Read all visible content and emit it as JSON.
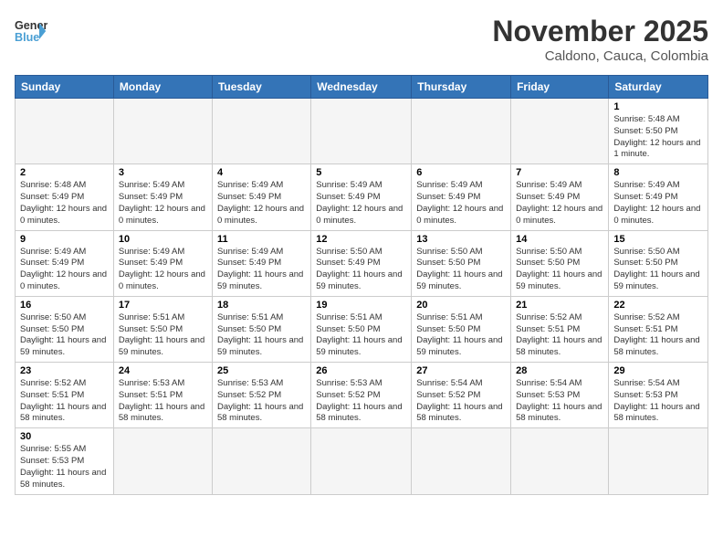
{
  "header": {
    "logo_general": "General",
    "logo_blue": "Blue",
    "month_title": "November 2025",
    "location": "Caldono, Cauca, Colombia"
  },
  "weekdays": [
    "Sunday",
    "Monday",
    "Tuesday",
    "Wednesday",
    "Thursday",
    "Friday",
    "Saturday"
  ],
  "weeks": [
    [
      {
        "day": "",
        "info": ""
      },
      {
        "day": "",
        "info": ""
      },
      {
        "day": "",
        "info": ""
      },
      {
        "day": "",
        "info": ""
      },
      {
        "day": "",
        "info": ""
      },
      {
        "day": "",
        "info": ""
      },
      {
        "day": "1",
        "info": "Sunrise: 5:48 AM\nSunset: 5:50 PM\nDaylight: 12 hours and 1 minute."
      }
    ],
    [
      {
        "day": "2",
        "info": "Sunrise: 5:48 AM\nSunset: 5:49 PM\nDaylight: 12 hours and 0 minutes."
      },
      {
        "day": "3",
        "info": "Sunrise: 5:49 AM\nSunset: 5:49 PM\nDaylight: 12 hours and 0 minutes."
      },
      {
        "day": "4",
        "info": "Sunrise: 5:49 AM\nSunset: 5:49 PM\nDaylight: 12 hours and 0 minutes."
      },
      {
        "day": "5",
        "info": "Sunrise: 5:49 AM\nSunset: 5:49 PM\nDaylight: 12 hours and 0 minutes."
      },
      {
        "day": "6",
        "info": "Sunrise: 5:49 AM\nSunset: 5:49 PM\nDaylight: 12 hours and 0 minutes."
      },
      {
        "day": "7",
        "info": "Sunrise: 5:49 AM\nSunset: 5:49 PM\nDaylight: 12 hours and 0 minutes."
      },
      {
        "day": "8",
        "info": "Sunrise: 5:49 AM\nSunset: 5:49 PM\nDaylight: 12 hours and 0 minutes."
      }
    ],
    [
      {
        "day": "9",
        "info": "Sunrise: 5:49 AM\nSunset: 5:49 PM\nDaylight: 12 hours and 0 minutes."
      },
      {
        "day": "10",
        "info": "Sunrise: 5:49 AM\nSunset: 5:49 PM\nDaylight: 12 hours and 0 minutes."
      },
      {
        "day": "11",
        "info": "Sunrise: 5:49 AM\nSunset: 5:49 PM\nDaylight: 11 hours and 59 minutes."
      },
      {
        "day": "12",
        "info": "Sunrise: 5:50 AM\nSunset: 5:49 PM\nDaylight: 11 hours and 59 minutes."
      },
      {
        "day": "13",
        "info": "Sunrise: 5:50 AM\nSunset: 5:50 PM\nDaylight: 11 hours and 59 minutes."
      },
      {
        "day": "14",
        "info": "Sunrise: 5:50 AM\nSunset: 5:50 PM\nDaylight: 11 hours and 59 minutes."
      },
      {
        "day": "15",
        "info": "Sunrise: 5:50 AM\nSunset: 5:50 PM\nDaylight: 11 hours and 59 minutes."
      }
    ],
    [
      {
        "day": "16",
        "info": "Sunrise: 5:50 AM\nSunset: 5:50 PM\nDaylight: 11 hours and 59 minutes."
      },
      {
        "day": "17",
        "info": "Sunrise: 5:51 AM\nSunset: 5:50 PM\nDaylight: 11 hours and 59 minutes."
      },
      {
        "day": "18",
        "info": "Sunrise: 5:51 AM\nSunset: 5:50 PM\nDaylight: 11 hours and 59 minutes."
      },
      {
        "day": "19",
        "info": "Sunrise: 5:51 AM\nSunset: 5:50 PM\nDaylight: 11 hours and 59 minutes."
      },
      {
        "day": "20",
        "info": "Sunrise: 5:51 AM\nSunset: 5:50 PM\nDaylight: 11 hours and 59 minutes."
      },
      {
        "day": "21",
        "info": "Sunrise: 5:52 AM\nSunset: 5:51 PM\nDaylight: 11 hours and 58 minutes."
      },
      {
        "day": "22",
        "info": "Sunrise: 5:52 AM\nSunset: 5:51 PM\nDaylight: 11 hours and 58 minutes."
      }
    ],
    [
      {
        "day": "23",
        "info": "Sunrise: 5:52 AM\nSunset: 5:51 PM\nDaylight: 11 hours and 58 minutes."
      },
      {
        "day": "24",
        "info": "Sunrise: 5:53 AM\nSunset: 5:51 PM\nDaylight: 11 hours and 58 minutes."
      },
      {
        "day": "25",
        "info": "Sunrise: 5:53 AM\nSunset: 5:52 PM\nDaylight: 11 hours and 58 minutes."
      },
      {
        "day": "26",
        "info": "Sunrise: 5:53 AM\nSunset: 5:52 PM\nDaylight: 11 hours and 58 minutes."
      },
      {
        "day": "27",
        "info": "Sunrise: 5:54 AM\nSunset: 5:52 PM\nDaylight: 11 hours and 58 minutes."
      },
      {
        "day": "28",
        "info": "Sunrise: 5:54 AM\nSunset: 5:53 PM\nDaylight: 11 hours and 58 minutes."
      },
      {
        "day": "29",
        "info": "Sunrise: 5:54 AM\nSunset: 5:53 PM\nDaylight: 11 hours and 58 minutes."
      }
    ],
    [
      {
        "day": "30",
        "info": "Sunrise: 5:55 AM\nSunset: 5:53 PM\nDaylight: 11 hours and 58 minutes."
      },
      {
        "day": "",
        "info": ""
      },
      {
        "day": "",
        "info": ""
      },
      {
        "day": "",
        "info": ""
      },
      {
        "day": "",
        "info": ""
      },
      {
        "day": "",
        "info": ""
      },
      {
        "day": "",
        "info": ""
      }
    ]
  ]
}
